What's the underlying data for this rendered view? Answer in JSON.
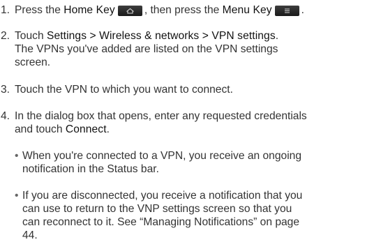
{
  "steps": [
    {
      "number": "1.",
      "pre": "Press the ",
      "home_key": "Home Key",
      "mid": ", then press the ",
      "menu_key": "Menu Key",
      "end": ".",
      "home_icon": "home-key-icon",
      "menu_icon": "menu-key-icon"
    },
    {
      "number": "2.",
      "pre": "Touch ",
      "path": "Settings > Wireless & networks > VPN settings",
      "end": ".",
      "line2": "The VPNs you've added are listed on the VPN settings",
      "line3": "screen."
    },
    {
      "number": "3.",
      "text": "Touch the VPN to which you want to connect."
    },
    {
      "number": "4.",
      "line1": "In the dialog box that opens, enter any requested credentials",
      "pre2": "and touch ",
      "connect": "Connect",
      "end2": "."
    }
  ],
  "bullets": [
    {
      "marker": "•",
      "line1": "When you're connected to a VPN, you receive an ongoing",
      "line2": "notification in the Status bar."
    },
    {
      "marker": "•",
      "line1": "If you are disconnected, you receive a notification that you",
      "line2": "can use to return to the VNP settings screen so that you",
      "line3": "can reconnect to it. See “Managing Notifications” on page",
      "line4": "44."
    }
  ]
}
